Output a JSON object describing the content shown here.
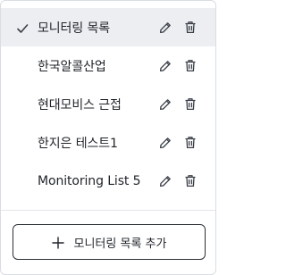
{
  "monitoring_lists": {
    "items": [
      {
        "label": "모니터링 목록",
        "selected": true
      },
      {
        "label": "한국알콜산업",
        "selected": false
      },
      {
        "label": "현대모비스 근접",
        "selected": false
      },
      {
        "label": "한지은 테스트1",
        "selected": false
      },
      {
        "label": "Monitoring List 5",
        "selected": false
      }
    ],
    "item_icons": {
      "check": "check-icon",
      "edit": "pencil-icon",
      "delete": "trash-icon"
    }
  },
  "add_button": {
    "label": "모니터링 목록 추가",
    "icon": "plus-icon"
  },
  "colors": {
    "selected_background": "#eceef1",
    "text": "#1f2329",
    "icon": "#3a3f47",
    "border": "#d9dde3"
  }
}
